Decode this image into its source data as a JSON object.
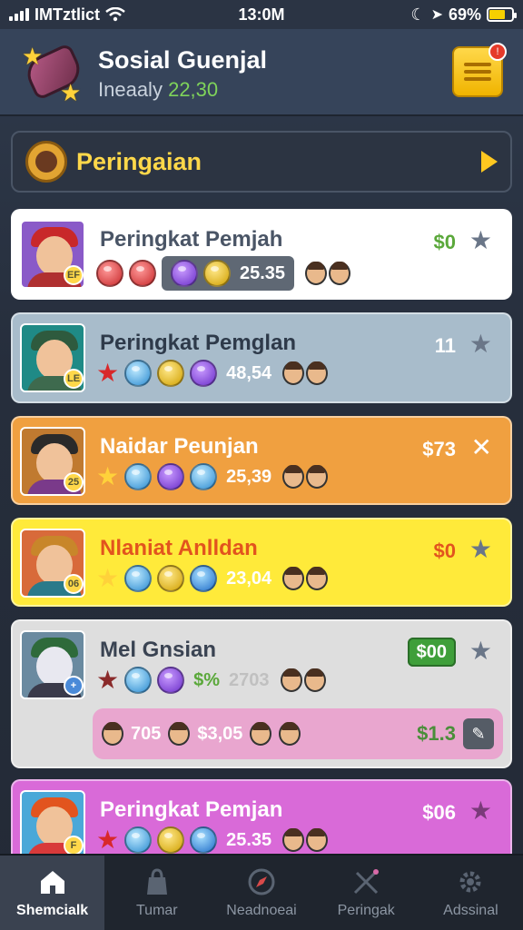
{
  "status": {
    "carrier": "IMTztlict",
    "time": "13:0M",
    "battery": "69%"
  },
  "header": {
    "title": "Sosial Guenjal",
    "subtitle_label": "Ineaaly",
    "subtitle_value": "22,30"
  },
  "banner": {
    "label": "Peringaian"
  },
  "players": [
    {
      "name": "Peringkat Pemjah",
      "amount": "$0",
      "score": "25.35",
      "badge": "EF",
      "colors": {
        "bg": "#ffffff",
        "name": "#4a5566",
        "amount": "#5aa83a",
        "score": "#ffffff"
      }
    },
    {
      "name": "Peringkat Pemglan",
      "amount": "11",
      "score": "48,54",
      "badge": "LE",
      "colors": {
        "bg": "#a8bccb",
        "name": "#2e3a4a",
        "amount": "#ffffff",
        "score": "#ffffff"
      }
    },
    {
      "name": "Naidar Peunjan",
      "amount": "$73",
      "score": "25,39",
      "badge": "25",
      "colors": {
        "bg": "#f0a040",
        "name": "#ffffff",
        "amount": "#ffffff",
        "score": "#ffffff"
      }
    },
    {
      "name": "Nlaniat Anlldan",
      "amount": "$0",
      "score": "23,04",
      "badge": "06",
      "colors": {
        "bg": "#ffea3a",
        "name": "#e2541e",
        "amount": "#e2541e",
        "score": "#ffffff"
      }
    },
    {
      "name": "Mel Gnsian",
      "amount": "$00",
      "score_prefix": "$%",
      "score": "2703",
      "colors": {
        "bg": "#dedede",
        "name": "#3a4352",
        "amount": "#ffffff",
        "score": "#c0c0c0"
      },
      "sub": {
        "count": "705",
        "value": "$3,05",
        "price": "$1.3"
      }
    },
    {
      "name": "Peringkat Pemjan",
      "amount": "$06",
      "score": "25.35",
      "badge": "F",
      "colors": {
        "bg": "#d96ad8",
        "name": "#ffffff",
        "amount": "#ffffff",
        "score": "#ffffff"
      }
    }
  ],
  "tabs": [
    {
      "label": "Shemcialk",
      "icon": "home-icon",
      "active": true
    },
    {
      "label": "Tumar",
      "icon": "bag-icon",
      "active": false
    },
    {
      "label": "Neadnoeai",
      "icon": "compass-icon",
      "active": false
    },
    {
      "label": "Peringak",
      "icon": "swords-icon",
      "active": false
    },
    {
      "label": "Adssinal",
      "icon": "gear-icon",
      "active": false
    }
  ]
}
